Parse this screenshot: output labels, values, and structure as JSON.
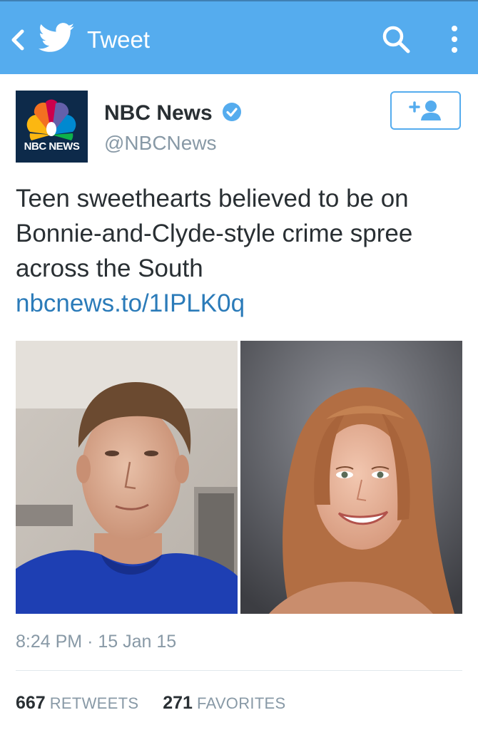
{
  "header": {
    "title": "Tweet",
    "back_icon": "chevron-left-icon",
    "brand_icon": "twitter-bird-icon",
    "search_icon": "search-icon",
    "more_icon": "vertical-dots-icon",
    "bar_color": "#55acee"
  },
  "author": {
    "name": "NBC News",
    "handle": "@NBCNews",
    "verified": true,
    "avatar_text": "NBC NEWS",
    "follow_icon": "add-user-icon"
  },
  "tweet": {
    "text": "Teen sweethearts believed to be on Bonnie-and-Clyde-style crime spree across the South",
    "link": "nbcnews.to/1IPLK0q",
    "link_color": "#2b7bb9"
  },
  "media": {
    "photos": [
      "young-man-in-blue-shirt-photo",
      "smiling-young-woman-portrait-photo"
    ]
  },
  "meta": {
    "time": "8:24 PM",
    "separator": "·",
    "date": "15 Jan 15"
  },
  "stats": {
    "retweets_count": "667",
    "retweets_label": "RETWEETS",
    "favorites_count": "271",
    "favorites_label": "FAVORITES"
  }
}
